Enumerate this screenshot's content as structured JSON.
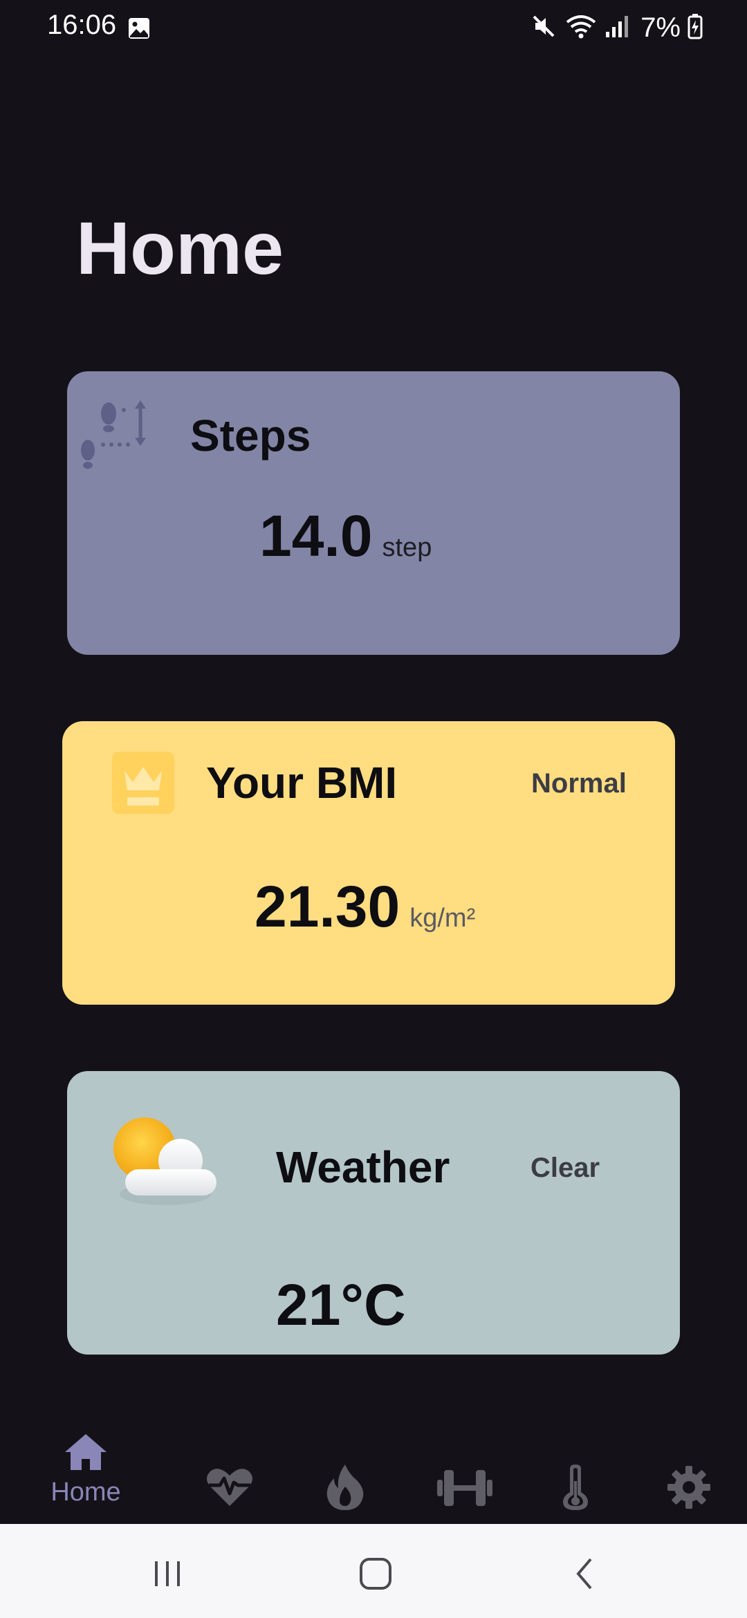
{
  "status_bar": {
    "time": "16:06",
    "battery": "7%",
    "icons": [
      "image-icon",
      "mute-icon",
      "wifi-icon",
      "signal-icon",
      "battery-charging-icon"
    ]
  },
  "page": {
    "title": "Home"
  },
  "cards": {
    "steps": {
      "title": "Steps",
      "value": "14.0",
      "unit": "step",
      "icon": "footsteps-icon",
      "color": "#8285a5"
    },
    "bmi": {
      "title": "Your BMI",
      "status": "Normal",
      "value": "21.30",
      "unit": "kg/m²",
      "icon": "bmi-scale-icon",
      "color": "#ffdd80"
    },
    "weather": {
      "title": "Weather",
      "status": "Clear",
      "value": "21°C",
      "icon": "sun-cloud-icon",
      "color": "#b4c6c8"
    }
  },
  "bottom_nav": {
    "items": [
      {
        "label": "Home",
        "icon": "home-icon",
        "active": true
      },
      {
        "label": "",
        "icon": "heart-rate-icon"
      },
      {
        "label": "",
        "icon": "flame-icon"
      },
      {
        "label": "",
        "icon": "dumbbell-icon"
      },
      {
        "label": "",
        "icon": "thermometer-icon"
      },
      {
        "label": "",
        "icon": "settings-gear-icon"
      }
    ],
    "active_color": "#8a86b8",
    "inactive_color": "#5f5e66"
  },
  "system_nav": {
    "icons": [
      "recent-apps-icon",
      "home-circle-icon",
      "back-icon"
    ]
  }
}
